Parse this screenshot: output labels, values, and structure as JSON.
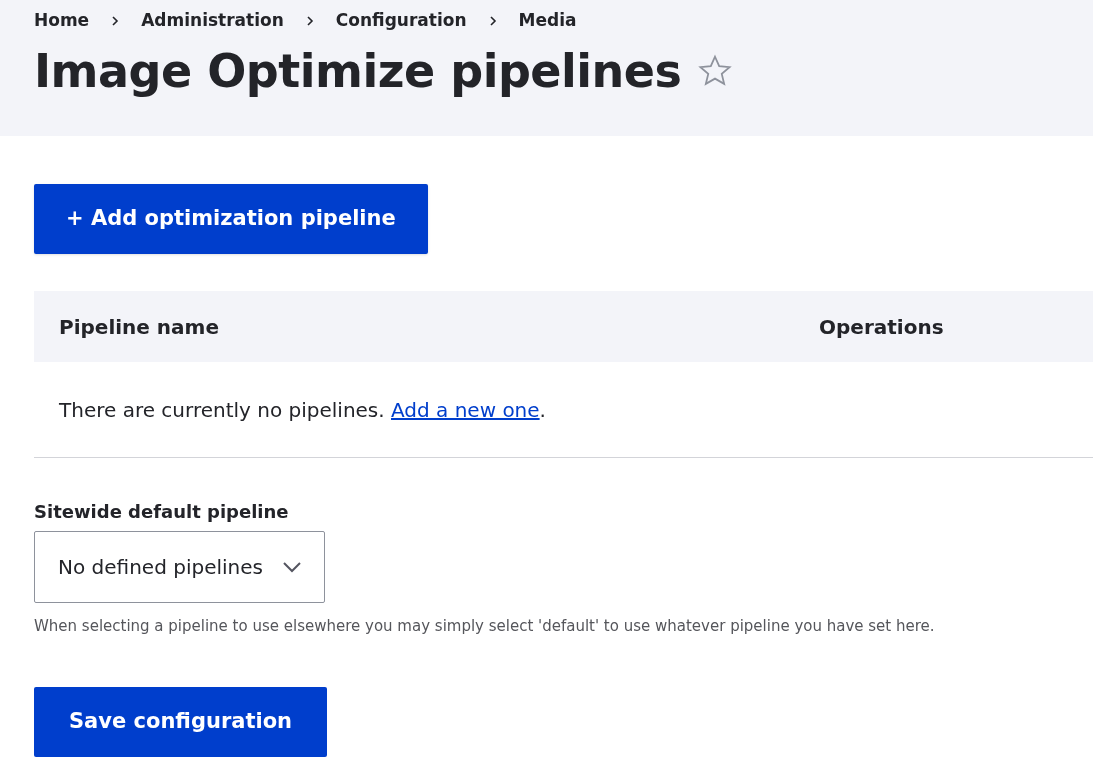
{
  "breadcrumb": [
    "Home",
    "Administration",
    "Configuration",
    "Media"
  ],
  "title": "Image Optimize pipelines",
  "add_button": "+ Add optimization pipeline",
  "table": {
    "columns": [
      "Pipeline name",
      "Operations"
    ],
    "empty_message": {
      "text": "There are currently no pipelines.",
      "link": "Add a new one",
      "end": "."
    }
  },
  "default_pipeline": {
    "label": "Sitewide default pipeline",
    "value": "No defined pipelines",
    "description": "When selecting a pipeline to use elsewhere you may simply select 'default' to use whatever pipeline you have set here."
  },
  "save_button": "Save configuration"
}
